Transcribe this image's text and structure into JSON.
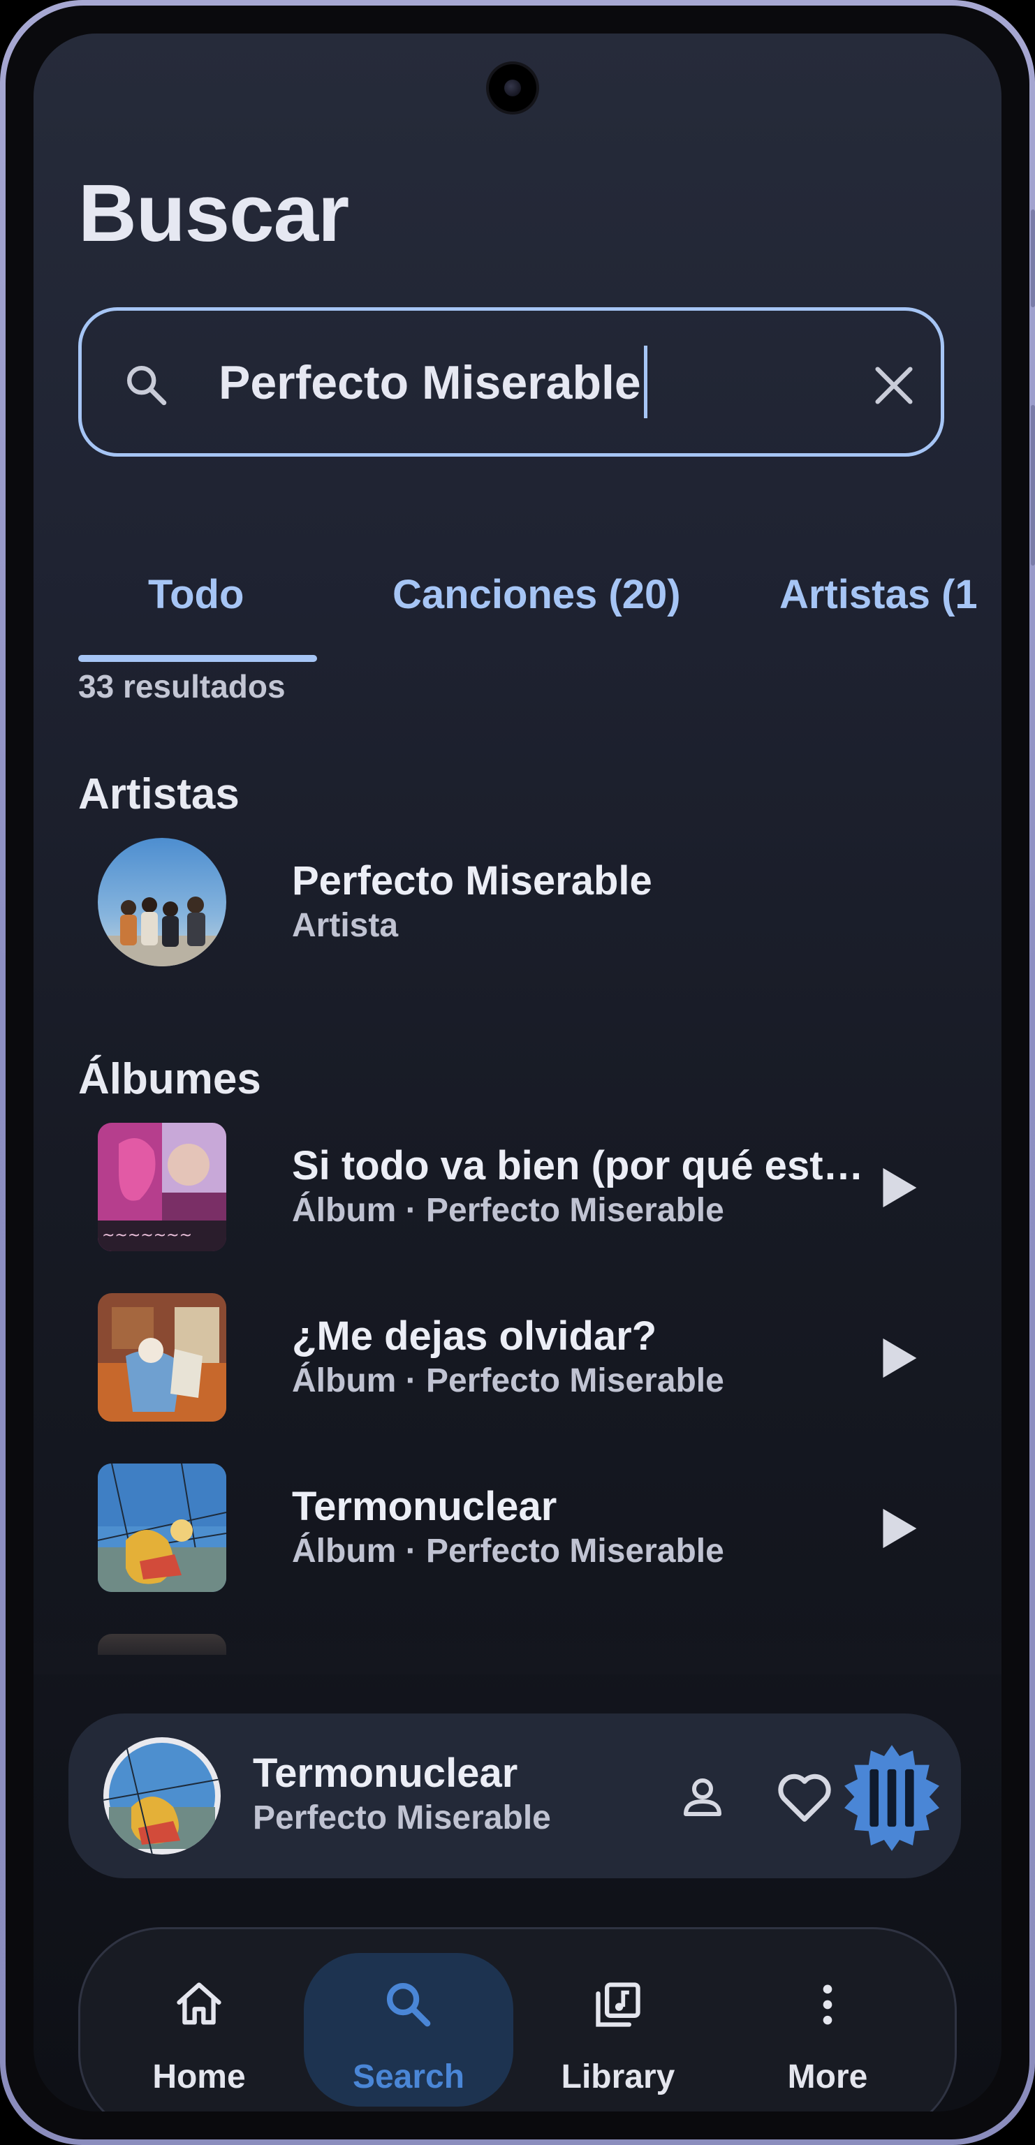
{
  "page": {
    "title": "Buscar"
  },
  "search": {
    "query": "Perfecto Miserable"
  },
  "tabs": [
    {
      "label": "Todo",
      "selected": true
    },
    {
      "label": "Canciones (20)",
      "selected": false
    },
    {
      "label": "Artistas (1",
      "selected": false
    }
  ],
  "results_count": "33 resultados",
  "sections": {
    "artists_title": "Artistas",
    "albums_title": "Álbumes"
  },
  "artist": {
    "name": "Perfecto Miserable",
    "type": "Artista"
  },
  "albums": [
    {
      "title": "Si todo va bien (por qué est…",
      "subtitle": "Álbum · Perfecto Miserable"
    },
    {
      "title": "¿Me dejas olvidar?",
      "subtitle": "Álbum · Perfecto Miserable"
    },
    {
      "title": "Termonuclear",
      "subtitle": "Álbum · Perfecto Miserable"
    }
  ],
  "now_playing": {
    "title": "Termonuclear",
    "artist": "Perfecto Miserable"
  },
  "nav": [
    {
      "label": "Home",
      "icon": "home-icon",
      "active": false
    },
    {
      "label": "Search",
      "icon": "search-icon",
      "active": true
    },
    {
      "label": "Library",
      "icon": "library-icon",
      "active": false
    },
    {
      "label": "More",
      "icon": "more-icon",
      "active": false
    }
  ],
  "colors": {
    "accent": "#a6c5f5",
    "nav_active": "#4a86d6",
    "background": "#1f2332",
    "player_bg": "#232938"
  }
}
